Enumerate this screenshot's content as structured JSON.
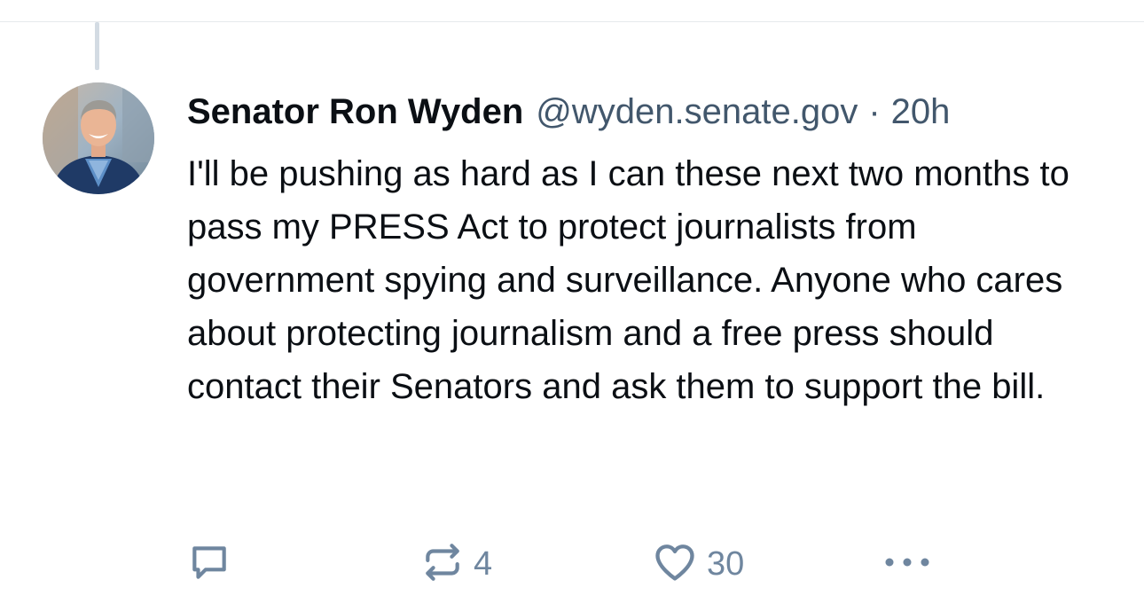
{
  "post": {
    "author": {
      "display_name": "Senator Ron Wyden",
      "handle": "@wyden.senate.gov"
    },
    "separator": "·",
    "timestamp": "20h",
    "text": "I'll be pushing as hard as I can these next two months to pass my PRESS Act to protect journalists from government spying and surveillance. Anyone who cares about protecting journalism and a free press should contact their Senators and ask them to support the bill."
  },
  "actions": {
    "reply": {
      "icon": "reply-icon"
    },
    "repost": {
      "icon": "repost-icon",
      "count": "4"
    },
    "like": {
      "icon": "heart-icon",
      "count": "30"
    },
    "more": {
      "icon": "more-options-icon"
    }
  },
  "colors": {
    "text": "#0b0f14",
    "secondary": "#42576c",
    "icon": "#6f869f",
    "thread_line": "#d3dbe3"
  }
}
